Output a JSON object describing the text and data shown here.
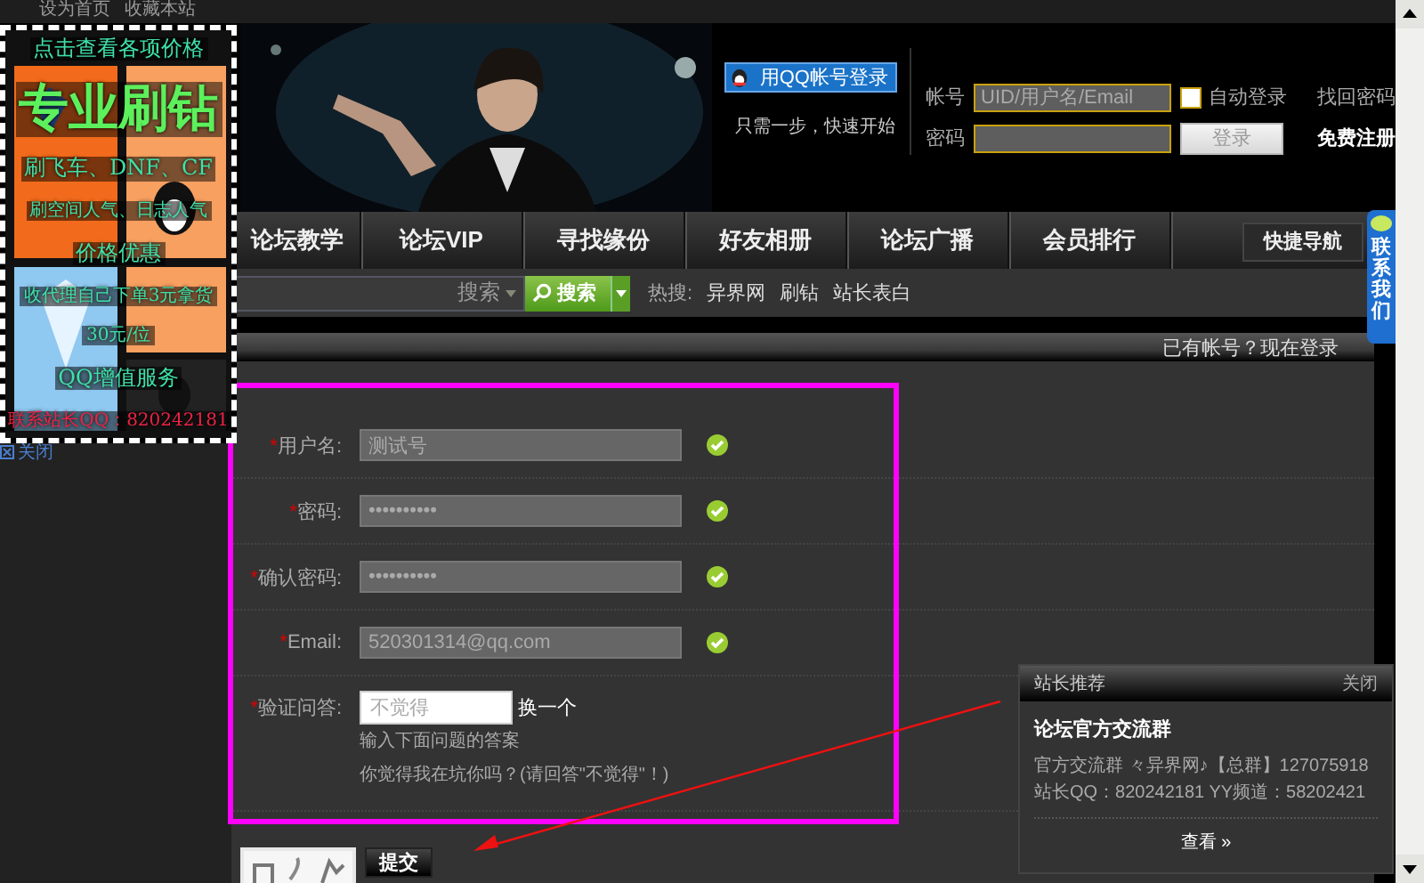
{
  "top_links": [
    "设为首页",
    "收藏本站"
  ],
  "header": {
    "qq_login": "用QQ帐号登录",
    "qq_hint": "只需一步，快速开始",
    "account_label": "帐号",
    "account_placeholder": "UID/用户名/Email",
    "auto_login": {
      "label": "自动登录",
      "checked": false
    },
    "forgot": "找回密码",
    "password_label": "密码",
    "login_button": "登录",
    "register": "免费注册"
  },
  "nav": {
    "items": [
      {
        "label": "论坛教学"
      },
      {
        "label": "论坛VIP"
      },
      {
        "label": "寻找缘份"
      },
      {
        "label": "好友相册"
      },
      {
        "label": "论坛广播"
      },
      {
        "label": "会员排行"
      }
    ],
    "quick_nav": "快捷导航"
  },
  "search": {
    "placeholder": "搜索",
    "button": "搜索",
    "hot_label": "热搜:",
    "hot": [
      "异界网",
      "刷钻",
      "站长表白"
    ]
  },
  "section": {
    "login_link": "已有帐号？现在登录"
  },
  "form": {
    "required_mark": "*",
    "fields": [
      {
        "label": "用户名:",
        "required": true,
        "value": "测试号",
        "valid": true
      },
      {
        "label": "密码:",
        "required": true,
        "value": "••••••••••",
        "valid": true
      },
      {
        "label": "确认密码:",
        "required": true,
        "value": "••••••••••",
        "valid": true
      },
      {
        "label": "Email:",
        "required": true,
        "value": "520301314@qq.com",
        "valid": true
      }
    ],
    "verify": {
      "label": "验证问答:",
      "required": true,
      "placeholder": "不觉得",
      "change": "换一个",
      "hint": "输入下面问题的答案",
      "question": "你觉得我在坑你吗？(请回答\"不觉得\"！)"
    },
    "submit": "提交"
  },
  "ad": {
    "lines": [
      "点击查看各项价格",
      "专业刷钻",
      "刷飞车、DNF、CF",
      "刷空间人气、日志人气",
      "价格优惠",
      "收代理自己下单3元拿货",
      "30元/位",
      "QQ增值服务",
      "联系站长QQ：820242181"
    ],
    "close": "关闭"
  },
  "contact_tab": "联系我们",
  "popup": {
    "title": "站长推荐",
    "close": "关闭",
    "heading": "论坛官方交流群",
    "text": "官方交流群 々异界网♪【总群】127075918 站长QQ：820242181 YY频道：58202421",
    "more": "查看 »"
  }
}
